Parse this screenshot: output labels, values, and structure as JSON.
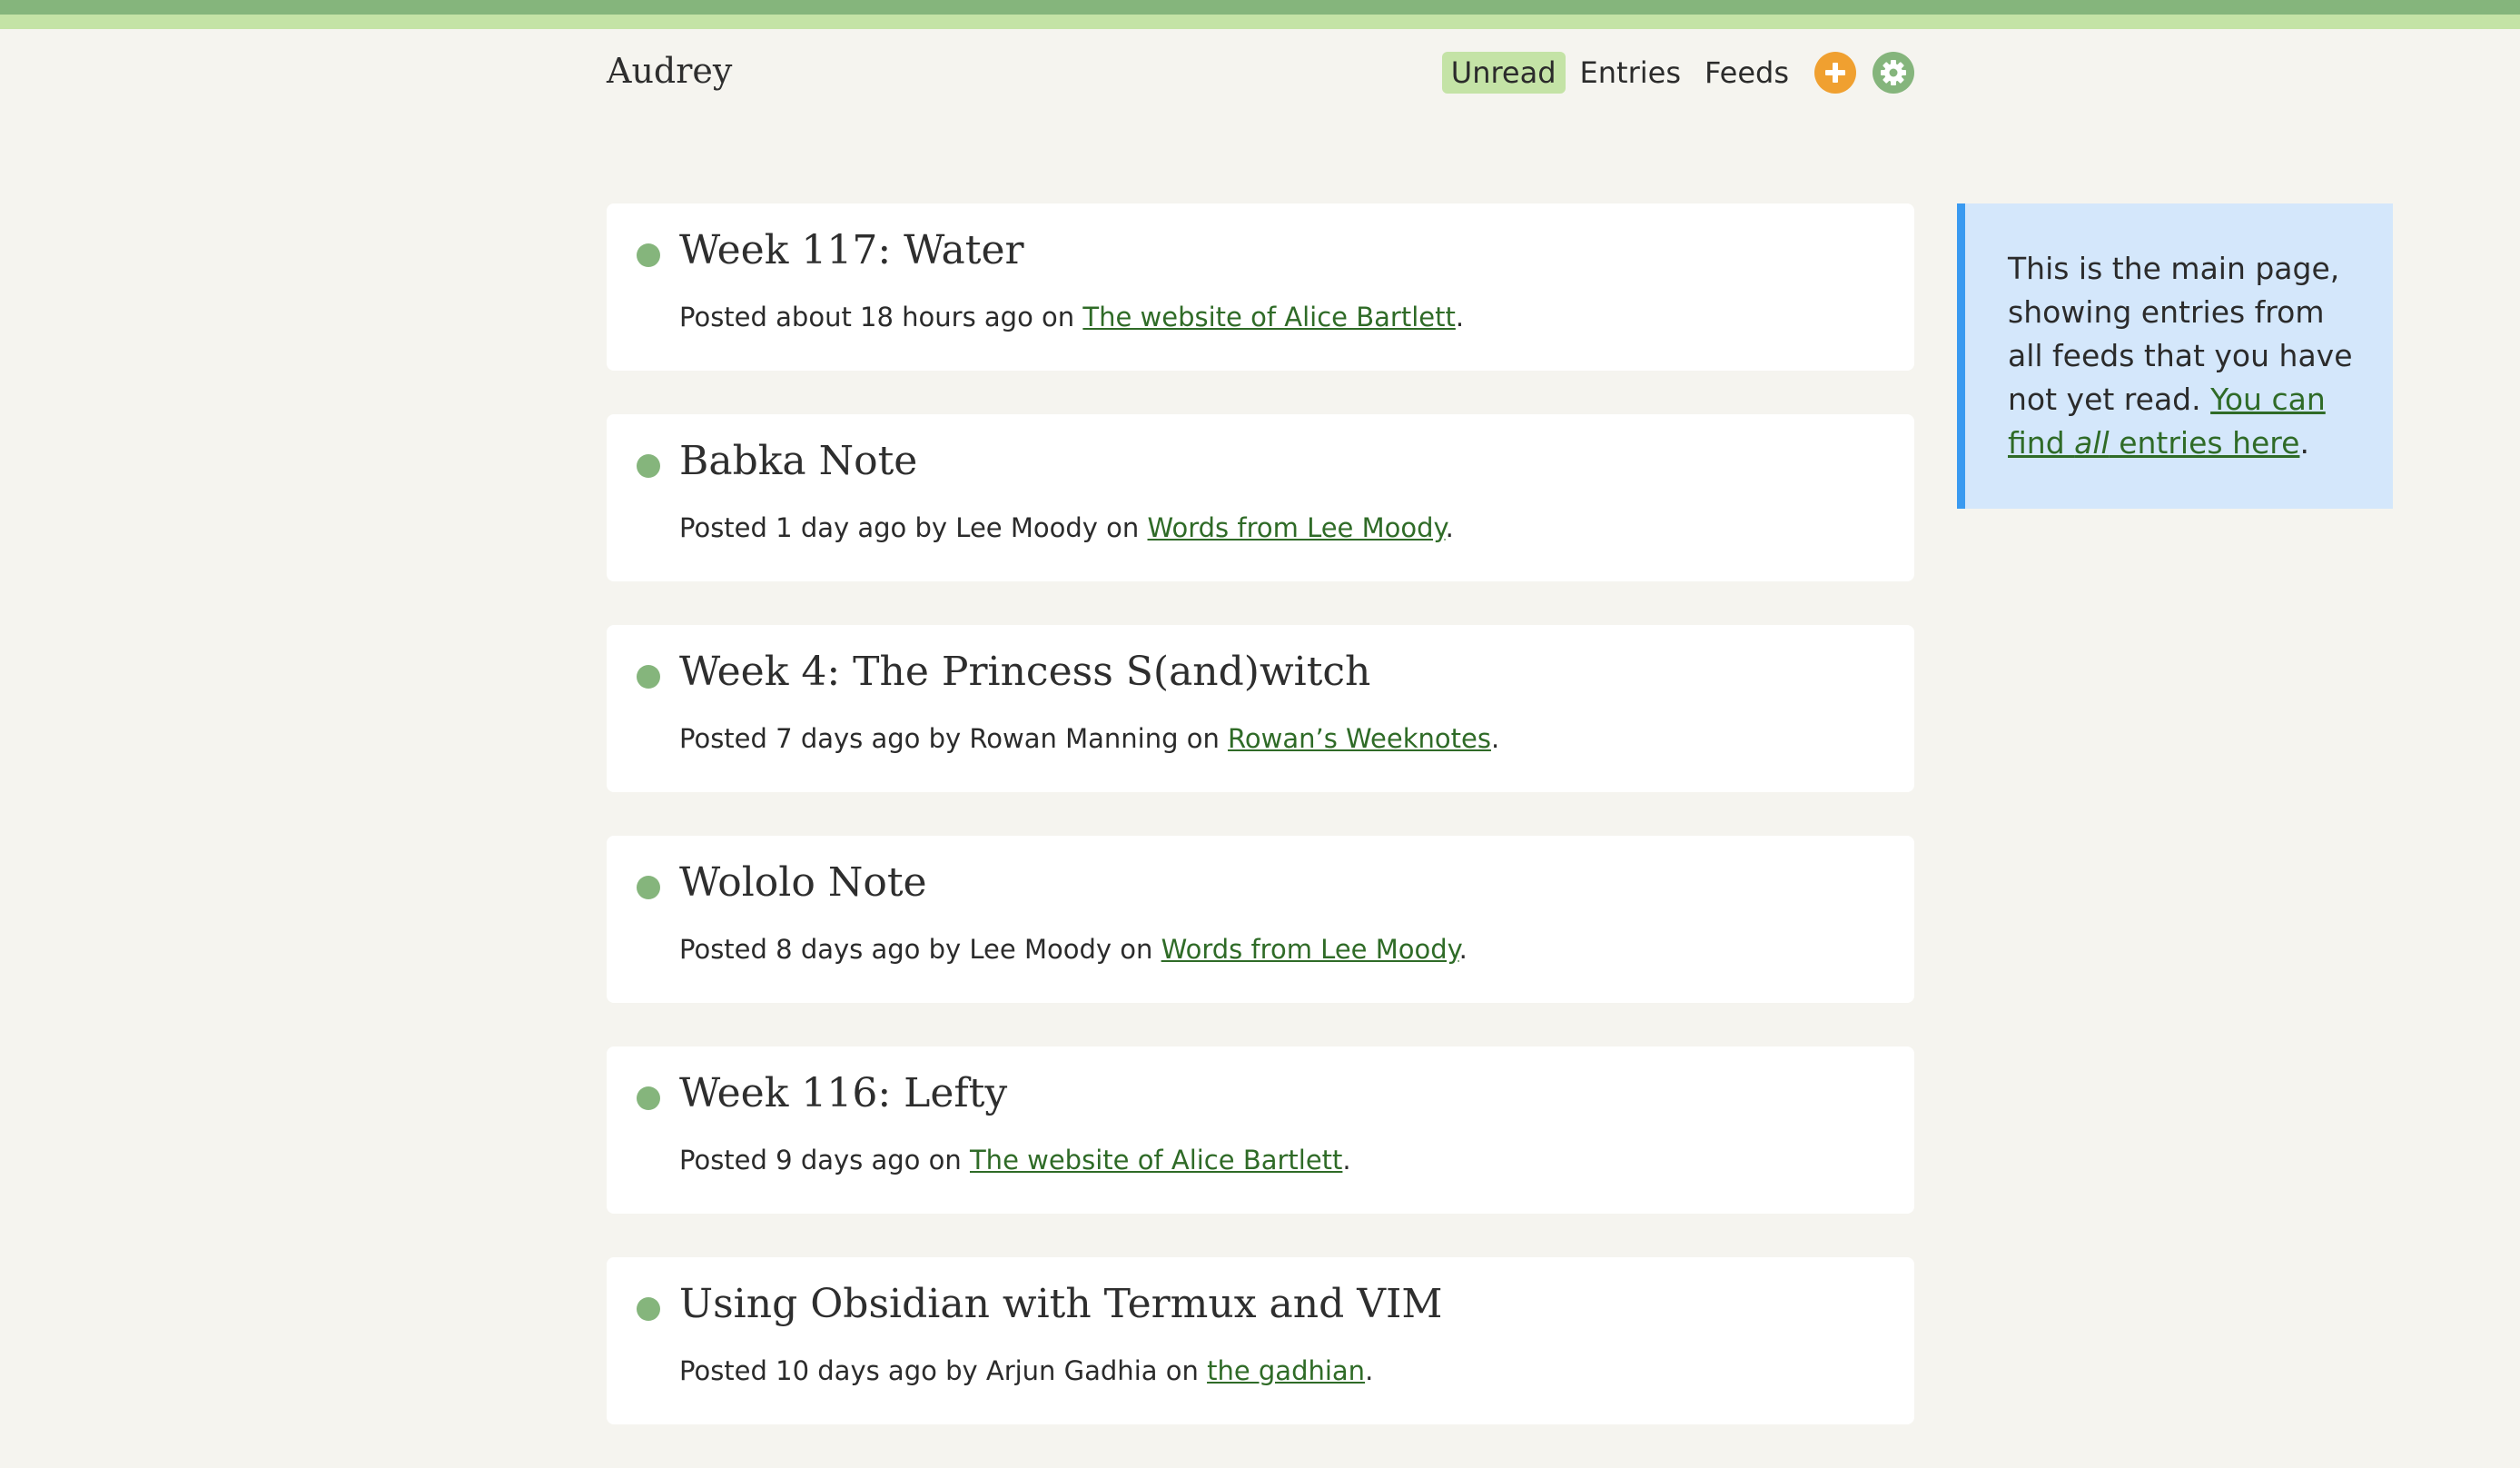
{
  "colors": {
    "accent_green": "#85b57c",
    "light_green": "#c4e3a6",
    "add_orange": "#f0a030",
    "link_green": "#2f6b27",
    "info_blue": "#d4e7fb",
    "info_border": "#3a9af0"
  },
  "header": {
    "brand": "Audrey",
    "nav": [
      {
        "label": "Unread",
        "active": true
      },
      {
        "label": "Entries",
        "active": false
      },
      {
        "label": "Feeds",
        "active": false
      }
    ],
    "add_icon": "plus-icon",
    "settings_icon": "gear-icon"
  },
  "entries": [
    {
      "title": "Week 117: Water",
      "prefix": "Posted about 18 hours ago on ",
      "feed": "The website of Alice Bartlett",
      "suffix": "."
    },
    {
      "title": "Babka Note",
      "prefix": "Posted 1 day ago by Lee Moody on ",
      "feed": "Words from Lee Moody",
      "suffix": "."
    },
    {
      "title": "Week 4: The Princess S(and)witch",
      "prefix": "Posted 7 days ago by Rowan Manning on ",
      "feed": "Rowan’s Weeknotes",
      "suffix": "."
    },
    {
      "title": "Wololo Note",
      "prefix": "Posted 8 days ago by Lee Moody on ",
      "feed": "Words from Lee Moody",
      "suffix": "."
    },
    {
      "title": "Week 116: Lefty",
      "prefix": "Posted 9 days ago on ",
      "feed": "The website of Alice Bartlett",
      "suffix": "."
    },
    {
      "title": "Using Obsidian with Termux and VIM",
      "prefix": "Posted 10 days ago by Arjun Gadhia on ",
      "feed": "the gadhian",
      "suffix": "."
    }
  ],
  "aside": {
    "text": "This is the main page, showing entries from all feeds that you have not yet read. ",
    "link_before": "You can find ",
    "link_em": "all",
    "link_after": " entries here",
    "end": "."
  }
}
